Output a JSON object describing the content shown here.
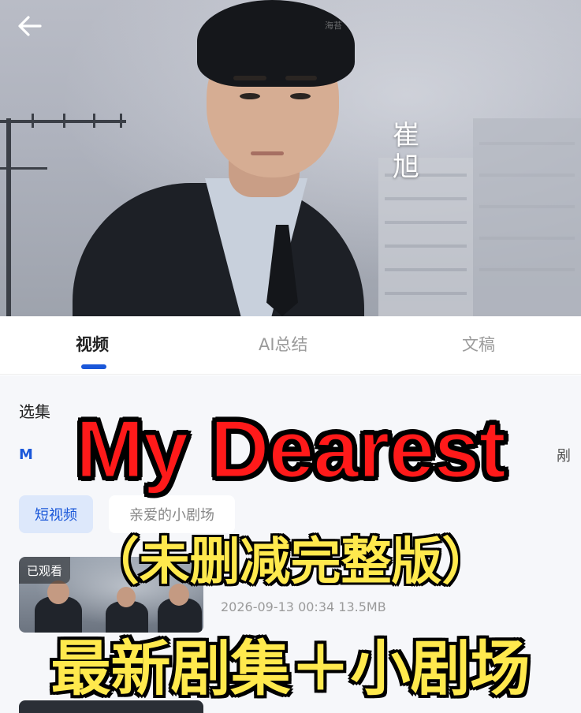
{
  "header": {
    "back_icon": "arrow-left-icon",
    "vertical_name_1": "崔",
    "vertical_name_2": "旭",
    "watermark": "海苔"
  },
  "tabs": [
    {
      "label": "视频",
      "active": true
    },
    {
      "label": "AI总结",
      "active": false
    },
    {
      "label": "文稿",
      "active": false
    }
  ],
  "episodes": {
    "section_title": "选集",
    "row_left": "M",
    "row_mid": "M",
    "row_right": "剐",
    "chips": [
      "短视频",
      "亲爱的小剧场"
    ]
  },
  "video_item": {
    "watched_label": "已观看",
    "meta": "2026-09-13 00:34 13.5MB"
  },
  "overlay": {
    "title": "My Dearest",
    "subtitle": "（未删减完整版）",
    "bottom": "最新剧集＋小剧场"
  },
  "colors": {
    "accent": "#1a57d9",
    "title_red": "#ff1a1a",
    "caption_yellow": "#ffe94d"
  }
}
